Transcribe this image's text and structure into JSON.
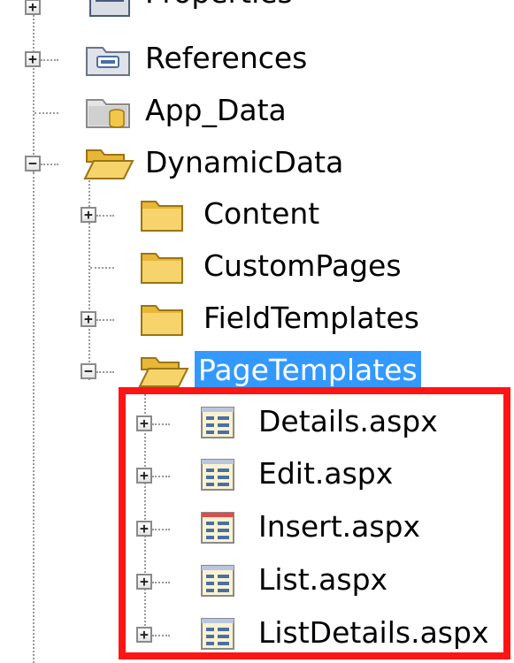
{
  "solution_explorer": {
    "items": [
      {
        "label": "Properties",
        "toggle": "none",
        "icon": "properties-icon"
      },
      {
        "label": "References",
        "toggle": "+",
        "icon": "references-icon"
      },
      {
        "label": "App_Data",
        "toggle": "none",
        "icon": "app-data-folder-icon"
      },
      {
        "label": "DynamicData",
        "toggle": "-",
        "icon": "folder-open-icon"
      },
      {
        "label": "Content",
        "toggle": "+",
        "icon": "folder-icon"
      },
      {
        "label": "CustomPages",
        "toggle": "none",
        "icon": "folder-icon"
      },
      {
        "label": "FieldTemplates",
        "toggle": "+",
        "icon": "folder-icon"
      },
      {
        "label": "PageTemplates",
        "toggle": "-",
        "icon": "folder-open-icon",
        "selected": true
      },
      {
        "label": "Details.aspx",
        "toggle": "+",
        "icon": "aspx-file-icon"
      },
      {
        "label": "Edit.aspx",
        "toggle": "+",
        "icon": "aspx-file-icon"
      },
      {
        "label": "Insert.aspx",
        "toggle": "+",
        "icon": "aspx-file-icon"
      },
      {
        "label": "List.aspx",
        "toggle": "+",
        "icon": "aspx-file-icon"
      },
      {
        "label": "ListDetails.aspx",
        "toggle": "+",
        "icon": "aspx-file-icon"
      }
    ],
    "toggle_symbols": {
      "expand": "+",
      "collapse": "−"
    }
  },
  "colors": {
    "selection": "#3399ff",
    "highlight_border": "#ff1414",
    "folder": "#f3c84a"
  }
}
